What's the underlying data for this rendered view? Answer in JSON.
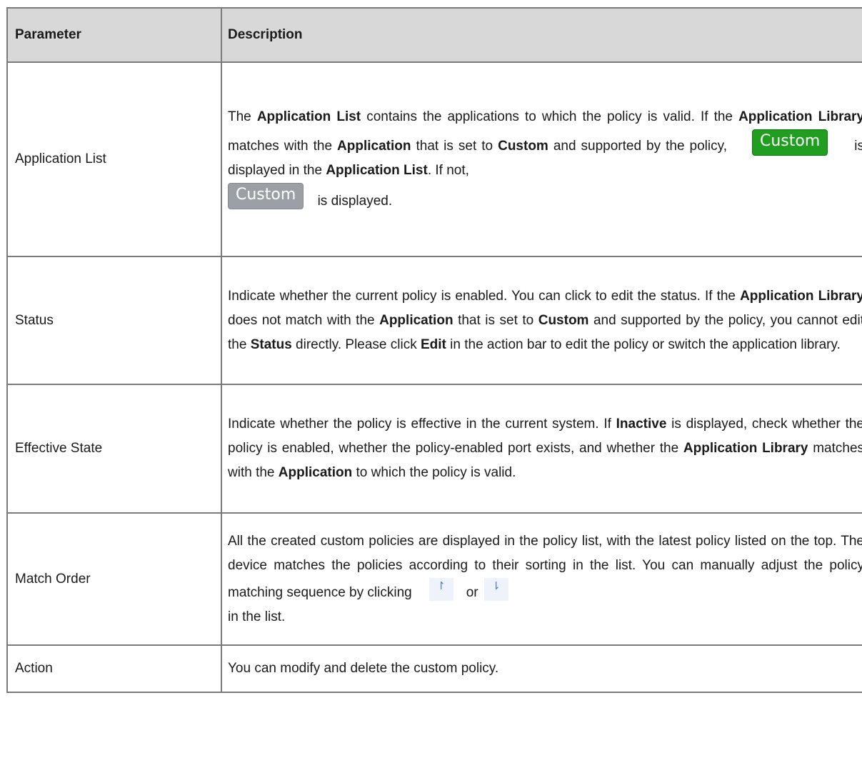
{
  "table": {
    "headers": {
      "parameter": "Parameter",
      "description": "Description"
    },
    "rows": [
      {
        "parameter": "Application List",
        "desc": {
          "t1": "The ",
          "b1": "Application List",
          "t2": " contains the applications to which the policy is valid. If the ",
          "b2": "Application Library",
          "t3": " matches with the ",
          "b3": "Application",
          "t4": " that is set to ",
          "b4": "Custom",
          "t5": " and supported by the policy, ",
          "tag_green": "Custom",
          "t6": " is displayed in the ",
          "b5": "Application List",
          "t7": ". If not, ",
          "tag_gray": "Custom",
          "t8": " is displayed."
        }
      },
      {
        "parameter": "Status",
        "desc": {
          "t1": "Indicate whether the current policy is enabled. You can click to edit the status. If the ",
          "b1": "Application Library",
          "t2": " does not match with the ",
          "b2": "Application",
          "t3": " that is set to ",
          "b3": "Custom",
          "t4": " and supported by the policy, you cannot edit the ",
          "b4": "Status",
          "t5": " directly. Please click ",
          "b5": "Edit",
          "t6": " in the action bar to edit the policy or switch the application library."
        }
      },
      {
        "parameter": "Effective State",
        "desc": {
          "t1": "Indicate whether the policy is effective in the current system. If ",
          "b1": "Inactive",
          "t2": " is displayed, check whether the policy is enabled, whether the policy-enabled port exists, and whether the ",
          "b2": "Application Library",
          "t3": " matches with the ",
          "b3": "Application",
          "t4": " to which the policy is valid."
        }
      },
      {
        "parameter": "Match Order",
        "desc": {
          "t1": "All the created custom policies are displayed in the policy list, with the latest policy listed on the top. The device matches the policies according to their sorting in the list. You can manually adjust the policy matching sequence by clicking",
          "icon_up": "↾",
          "t2": "or",
          "icon_down": "⇂",
          "t3": "in the list."
        }
      },
      {
        "parameter": "Action",
        "desc": {
          "t1": "You can modify and delete the custom policy."
        }
      }
    ]
  },
  "colors": {
    "header_bg": "#d8d8d8",
    "tag_green": "#1f9e1f",
    "tag_gray": "#9aa0a6",
    "border": "#7a7a7a"
  }
}
